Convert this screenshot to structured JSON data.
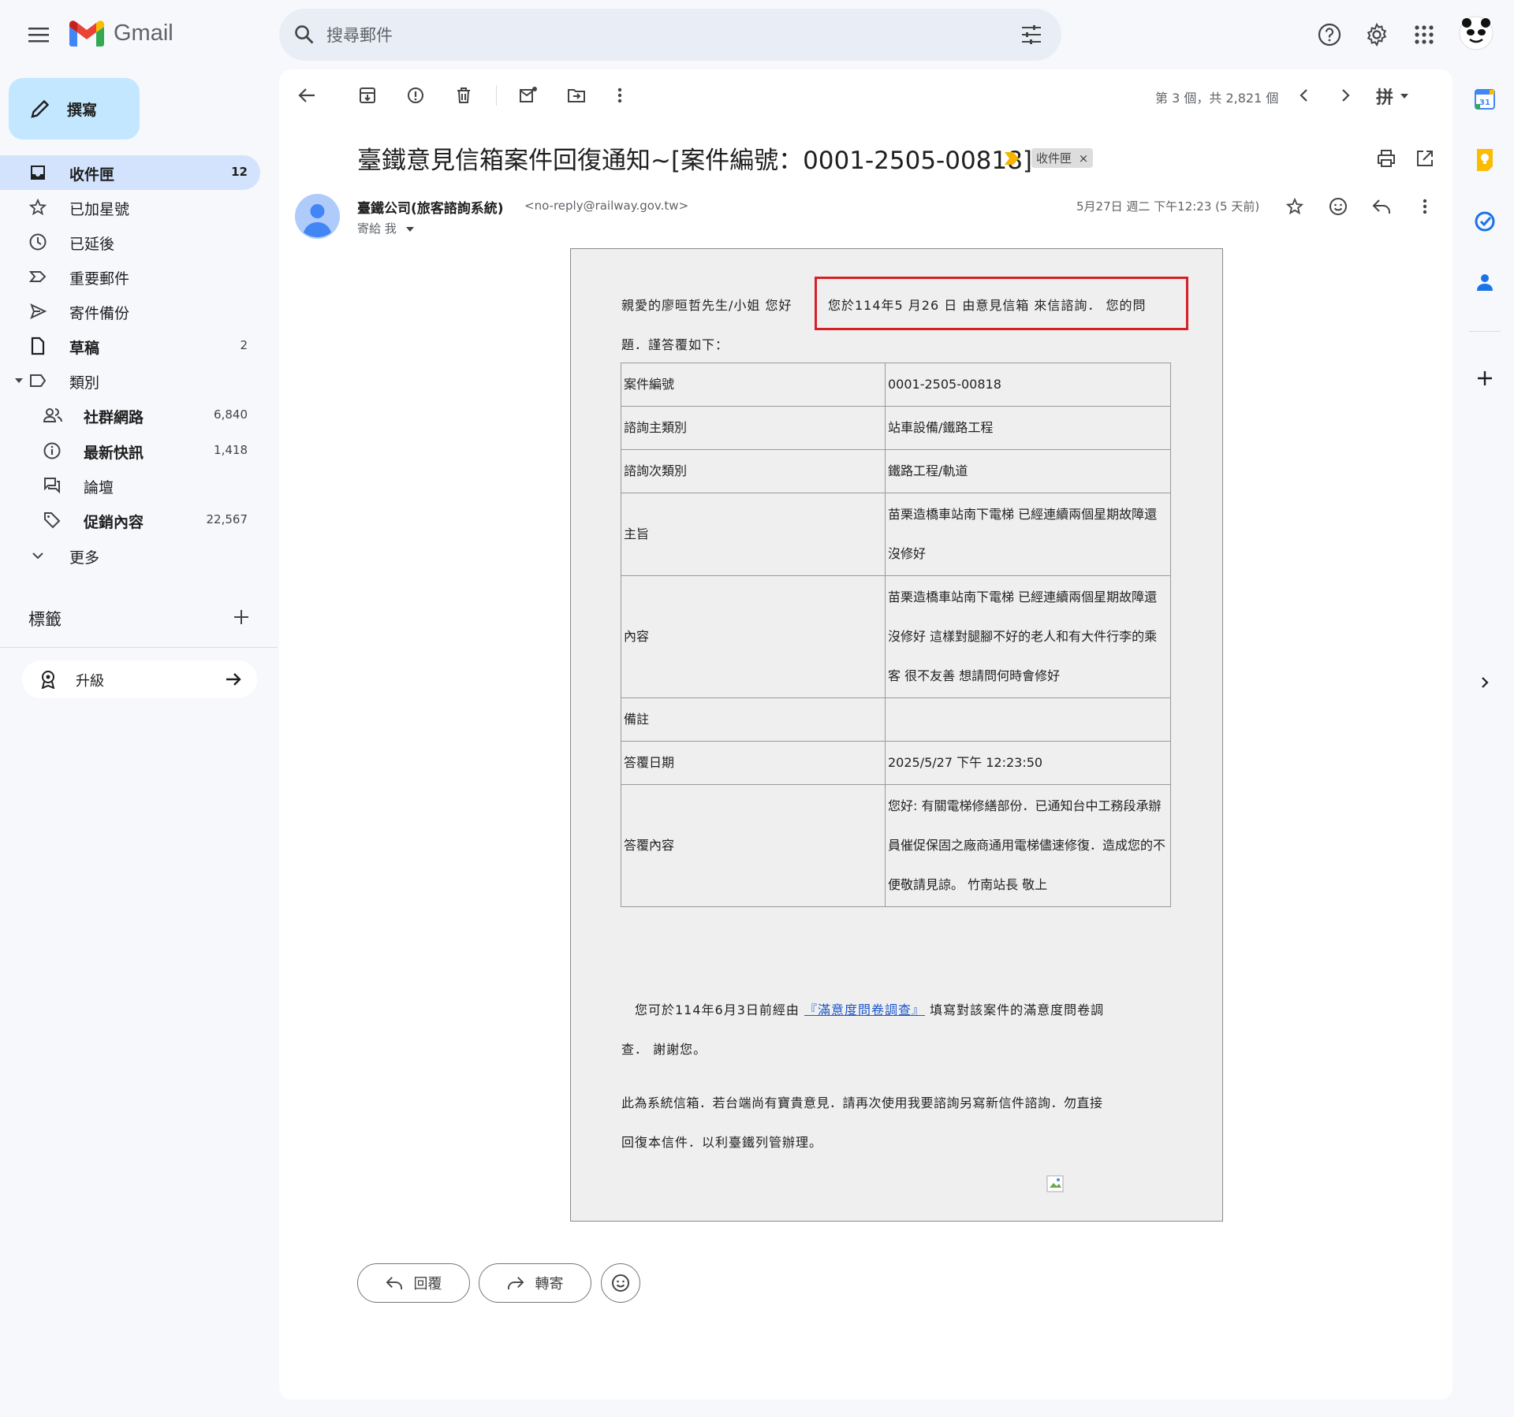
{
  "app": {
    "name": "Gmail"
  },
  "search": {
    "placeholder": "搜尋郵件"
  },
  "compose": {
    "label": "撰寫"
  },
  "nav": {
    "inbox": {
      "label": "收件匣",
      "count": "12"
    },
    "starred": {
      "label": "已加星號"
    },
    "snoozed": {
      "label": "已延後"
    },
    "important": {
      "label": "重要郵件"
    },
    "sent": {
      "label": "寄件備份"
    },
    "drafts": {
      "label": "草稿",
      "count": "2"
    },
    "categories": {
      "label": "類別"
    },
    "social": {
      "label": "社群網路",
      "count": "6,840"
    },
    "updates": {
      "label": "最新快訊",
      "count": "1,418"
    },
    "forums": {
      "label": "論壇"
    },
    "promotions": {
      "label": "促銷內容",
      "count": "22,567"
    },
    "more": {
      "label": "更多"
    }
  },
  "labels": {
    "title": "標籤"
  },
  "upgrade": {
    "label": "升級"
  },
  "toolbar": {
    "pagination": "第 3 個，共 2,821 個",
    "input_tool": "拼"
  },
  "email": {
    "subject": "臺鐵意見信箱案件回復通知~[案件編號：0001-2505-00818]",
    "label_badge": "收件匣",
    "label_badge_close": "×",
    "sender_name": "臺鐵公司(旅客諮詢系統)",
    "sender_email": "<no-reply@railway.gov.tw>",
    "to": "寄給 我",
    "date": "5月27日 週二 下午12:23 (5 天前)",
    "body": {
      "greeting": "親愛的廖晅哲先生/小姐 您好",
      "intro_highlight": "您於114年5 月26 日 由意見信箱 來信諮詢．  您的問",
      "intro_cont": "題．謹答覆如下：",
      "rows": [
        {
          "key": "案件編號",
          "value": "0001-2505-00818"
        },
        {
          "key": "諮詢主類別",
          "value": "站車設備/鐵路工程"
        },
        {
          "key": "諮詢次類別",
          "value": "鐵路工程/軌道"
        },
        {
          "key": "主旨",
          "value": "苗栗造橋車站南下電梯 已經連續兩個星期故障還沒修好"
        },
        {
          "key": "內容",
          "value": "苗栗造橋車站南下電梯 已經連續兩個星期故障還沒修好 這樣對腿腳不好的老人和有大件行李的乘客 很不友善 想請問何時會修好"
        },
        {
          "key": "備註",
          "value": ""
        },
        {
          "key": "答覆日期",
          "value": "2025/5/27 下午 12:23:50"
        },
        {
          "key": "答覆內容",
          "value": "您好: 有關電梯修繕部份．已通知台中工務段承辦員催促保固之廠商通用電梯儘速修復．造成您的不便敬請見諒。 竹南站長 敬上"
        }
      ],
      "survey_pre": "您可於114年6月3日前經由",
      "survey_link": "『滿意度問卷調查』",
      "survey_post": "填寫對該案件的滿意度問卷調",
      "survey_cont": "查．  謝謝您。",
      "footer_1": "此為系統信箱．若台端尚有寶貴意見．請再次使用我要諮詢另寫新信件諮詢．勿直接",
      "footer_2": "回復本信件．以利臺鐵列管辦理。"
    }
  },
  "actions": {
    "reply": "回覆",
    "forward": "轉寄"
  },
  "rail": {
    "calendar_day": "31"
  },
  "colors": {
    "accent": "#c2e7ff",
    "active_nav": "#d3e3fd",
    "highlight_box": "#d62027",
    "link": "#1a56c9"
  }
}
